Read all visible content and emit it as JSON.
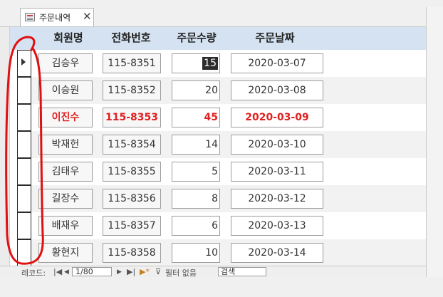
{
  "tab": {
    "title": "주문내역",
    "close": "✕",
    "icon": "form-icon"
  },
  "columns": {
    "name": "회원명",
    "phone": "전화번호",
    "qty": "주문수량",
    "date": "주문날짜"
  },
  "rows": [
    {
      "name": "김승우",
      "phone": "115-8351",
      "qty": "15",
      "date": "2020-03-07",
      "current": true,
      "highlight": false
    },
    {
      "name": "이승원",
      "phone": "115-8352",
      "qty": "20",
      "date": "2020-03-08",
      "current": false,
      "highlight": false
    },
    {
      "name": "이진수",
      "phone": "115-8353",
      "qty": "45",
      "date": "2020-03-09",
      "current": false,
      "highlight": true
    },
    {
      "name": "박재헌",
      "phone": "115-8354",
      "qty": "14",
      "date": "2020-03-10",
      "current": false,
      "highlight": false
    },
    {
      "name": "김태우",
      "phone": "115-8355",
      "qty": "5",
      "date": "2020-03-11",
      "current": false,
      "highlight": false
    },
    {
      "name": "길장수",
      "phone": "115-8356",
      "qty": "8",
      "date": "2020-03-12",
      "current": false,
      "highlight": false
    },
    {
      "name": "배재우",
      "phone": "115-8357",
      "qty": "6",
      "date": "2020-03-13",
      "current": false,
      "highlight": false
    },
    {
      "name": "황현지",
      "phone": "115-8358",
      "qty": "10",
      "date": "2020-03-14",
      "current": false,
      "highlight": false
    }
  ],
  "navigation": {
    "record_label": "레코드:",
    "first": "|◀",
    "prev": "◀",
    "position": "1/80",
    "next": "▶",
    "last": "▶|",
    "new": "▶*",
    "filter": "필터 없음",
    "search_placeholder": "검색"
  },
  "colors": {
    "header_bg": "#d5e2f1",
    "highlight_text": "#e02020",
    "annotation": "#e01010"
  }
}
